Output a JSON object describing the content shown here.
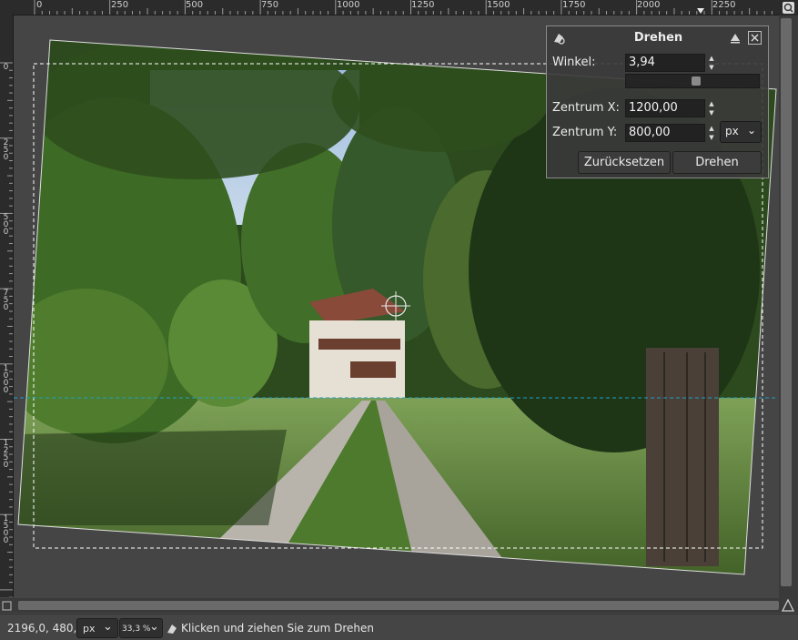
{
  "ruler_top": {
    "labels": [
      "0",
      "250",
      "500",
      "750",
      "1000",
      "1250",
      "1500",
      "1750",
      "2000",
      "2250"
    ]
  },
  "ruler_left": {
    "labels": [
      "0",
      "250",
      "500",
      "750",
      "1000",
      "1250",
      "1500"
    ]
  },
  "dialog": {
    "title": "Drehen",
    "angle_label": "Winkel:",
    "angle_value": "3,94",
    "center_x_label": "Zentrum X:",
    "center_x_value": "1200,00",
    "center_y_label": "Zentrum Y:",
    "center_y_value": "800,00",
    "unit": "px",
    "reset_label": "Zurücksetzen",
    "rotate_label": "Drehen",
    "angle_slider_fraction": 0.53
  },
  "status": {
    "coordinates": "2196,0, 480,0",
    "unit": "px",
    "zoom": "33,3 %",
    "message": "Klicken und ziehen Sie zum Drehen"
  },
  "colors": {
    "ruler_bg": "#2b2b2b",
    "canvas_bg": "#454545",
    "guide": "#1ea0c8"
  },
  "icons": {
    "nav": "navigate-icon",
    "dialog_tool": "rotate-tool-icon",
    "pin": "pin-icon",
    "close": "close-icon",
    "quickmask": "quick-mask-icon",
    "zoom_corner": "zoom-icon"
  }
}
